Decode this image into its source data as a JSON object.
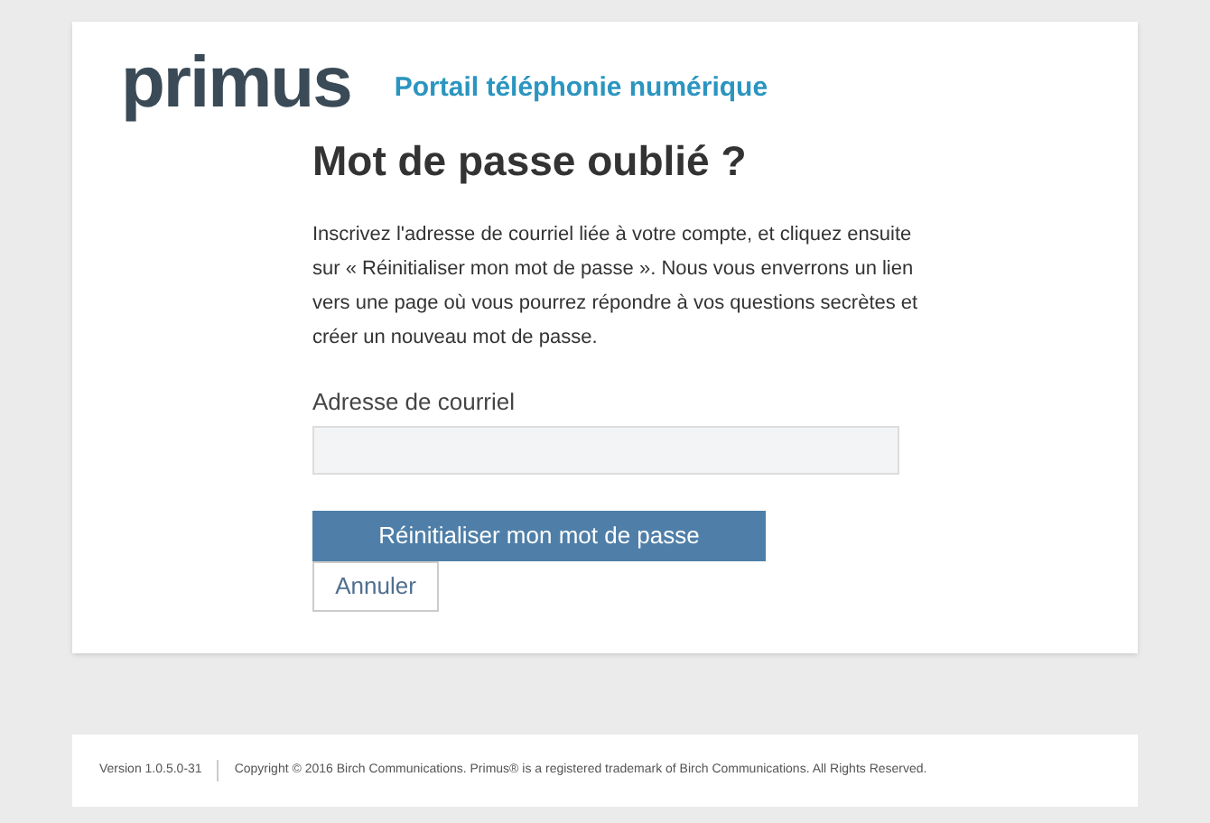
{
  "header": {
    "logo": "primus",
    "portal_title": "Portail téléphonie numérique"
  },
  "form": {
    "title": "Mot de passe oublié ?",
    "instructions": "Inscrivez l'adresse de courriel liée à votre compte, et cliquez ensuite sur « Réinitialiser mon mot de passe ». Nous vous enverrons un lien vers une page où vous pourrez répondre à vos questions secrètes et créer un nouveau mot de passe.",
    "email_label": "Adresse de courriel",
    "submit_button": "Réinitialiser mon mot de passe",
    "cancel_button": "Annuler"
  },
  "footer": {
    "version": "Version 1.0.5.0-31",
    "copyright": "Copyright © 2016 Birch Communications. Primus® is a registered trademark of Birch Communications. All Rights Reserved."
  }
}
